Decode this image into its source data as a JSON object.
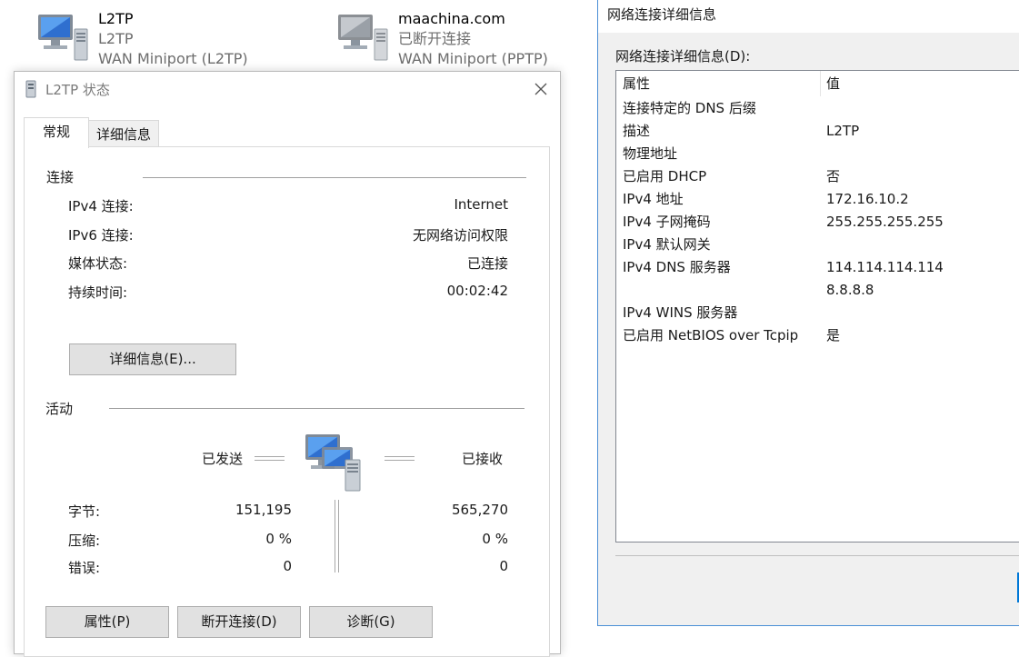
{
  "connections": [
    {
      "name": "L2TP",
      "status": "L2TP",
      "device": "WAN Miniport (L2TP)"
    },
    {
      "name": "maachina.com",
      "status": "已断开连接",
      "device": "WAN Miniport (PPTP)"
    }
  ],
  "status_dialog": {
    "title": "L2TP 状态",
    "tabs": {
      "general": "常规",
      "details": "详细信息"
    },
    "connection": {
      "title": "连接",
      "rows": [
        {
          "label": "IPv4 连接:",
          "value": "Internet"
        },
        {
          "label": "IPv6 连接:",
          "value": "无网络访问权限"
        },
        {
          "label": "媒体状态:",
          "value": "已连接"
        },
        {
          "label": "持续时间:",
          "value": "00:02:42"
        }
      ],
      "details_button": "详细信息(E)..."
    },
    "activity": {
      "title": "活动",
      "sent_label": "已发送",
      "received_label": "已接收",
      "rows": [
        {
          "label": "字节:",
          "sent": "151,195",
          "received": "565,270"
        },
        {
          "label": "压缩:",
          "sent": "0 %",
          "received": "0 %"
        },
        {
          "label": "错误:",
          "sent": "0",
          "received": "0"
        }
      ]
    },
    "buttons": {
      "properties": "属性(P)",
      "disconnect": "断开连接(D)",
      "diagnose": "诊断(G)"
    }
  },
  "details_dialog": {
    "title": "网络连接详细信息",
    "list_label": "网络连接详细信息(D):",
    "columns": {
      "property": "属性",
      "value": "值"
    },
    "rows": [
      {
        "property": "连接特定的 DNS 后缀",
        "value": ""
      },
      {
        "property": "描述",
        "value": "L2TP"
      },
      {
        "property": "物理地址",
        "value": ""
      },
      {
        "property": "已启用 DHCP",
        "value": "否"
      },
      {
        "property": "IPv4 地址",
        "value": "172.16.10.2"
      },
      {
        "property": "IPv4 子网掩码",
        "value": "255.255.255.255"
      },
      {
        "property": "IPv4 默认网关",
        "value": ""
      },
      {
        "property": "IPv4 DNS 服务器",
        "value": "114.114.114.114"
      },
      {
        "property": "",
        "value": "8.8.8.8"
      },
      {
        "property": "IPv4 WINS 服务器",
        "value": ""
      },
      {
        "property": "已启用 NetBIOS over Tcpip",
        "value": "是"
      }
    ]
  },
  "colors": {
    "accent": "#0078d7",
    "window_border": "#4a8fd6",
    "muted_text": "#6d6d6d"
  },
  "icons": [
    "network-connection-icon",
    "close-icon",
    "network-activity-icon"
  ]
}
